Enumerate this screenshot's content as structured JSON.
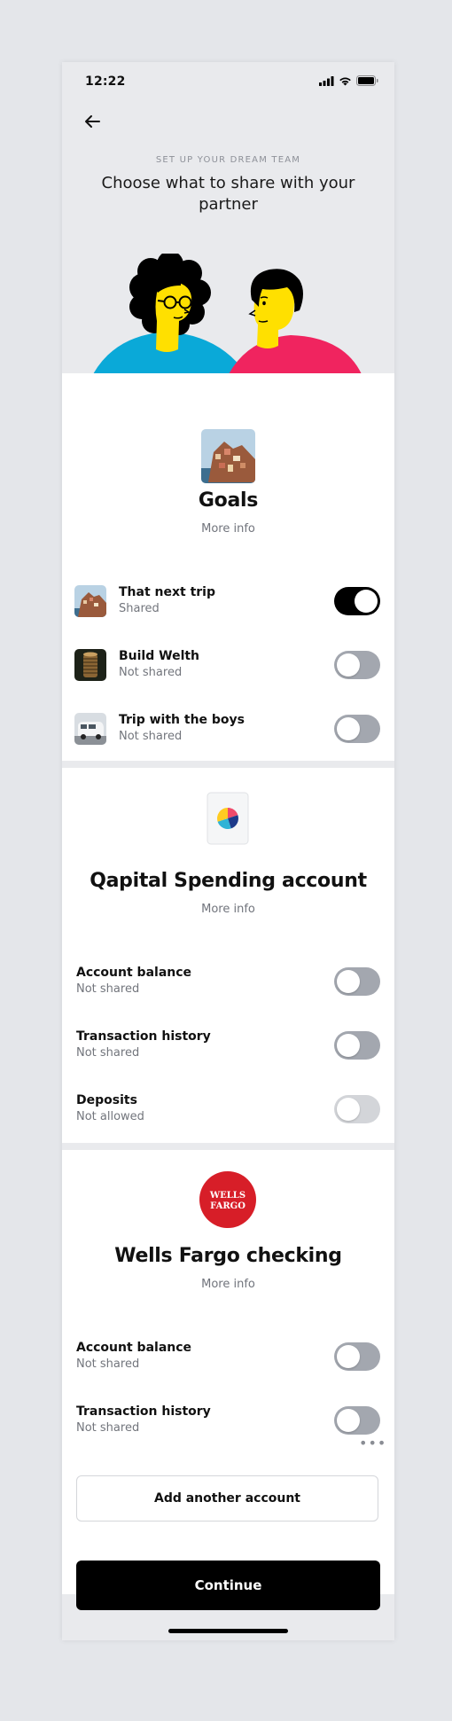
{
  "status_bar": {
    "time": "12:22"
  },
  "header": {
    "eyebrow": "SET UP YOUR DREAM TEAM",
    "title": "Choose what to share with your partner"
  },
  "goals": {
    "title": "Goals",
    "more_info": "More info",
    "items": [
      {
        "label": "That next trip",
        "status": "Shared",
        "on": true,
        "icon": "coastal-village-photo"
      },
      {
        "label": "Build Welth",
        "status": "Not shared",
        "on": false,
        "icon": "coin-stack-photo"
      },
      {
        "label": "Trip with the boys",
        "status": "Not shared",
        "on": false,
        "icon": "van-photo"
      }
    ]
  },
  "qapital": {
    "title": "Qapital Spending account",
    "more_info": "More info",
    "icon": "qapital-logo",
    "items": [
      {
        "label": "Account balance",
        "status": "Not shared",
        "on": false
      },
      {
        "label": "Transaction history",
        "status": "Not shared",
        "on": false
      },
      {
        "label": "Deposits",
        "status": "Not allowed",
        "on": false,
        "disabled": true
      }
    ]
  },
  "wells_fargo": {
    "title": "Wells Fargo checking",
    "more_info": "More info",
    "logo_line1": "WELLS",
    "logo_line2": "FARGO",
    "logo_color": "#d71e28",
    "items": [
      {
        "label": "Account balance",
        "status": "Not shared",
        "on": false
      },
      {
        "label": "Transaction history",
        "status": "Not shared",
        "on": false
      }
    ]
  },
  "actions": {
    "add_account": "Add another account",
    "continue": "Continue"
  },
  "colors": {
    "accent": "#000000",
    "toggle_off": "#a3a7af",
    "woman_shirt": "#0aa9d8",
    "man_shirt": "#f0245f",
    "skin": "#ffe000"
  }
}
